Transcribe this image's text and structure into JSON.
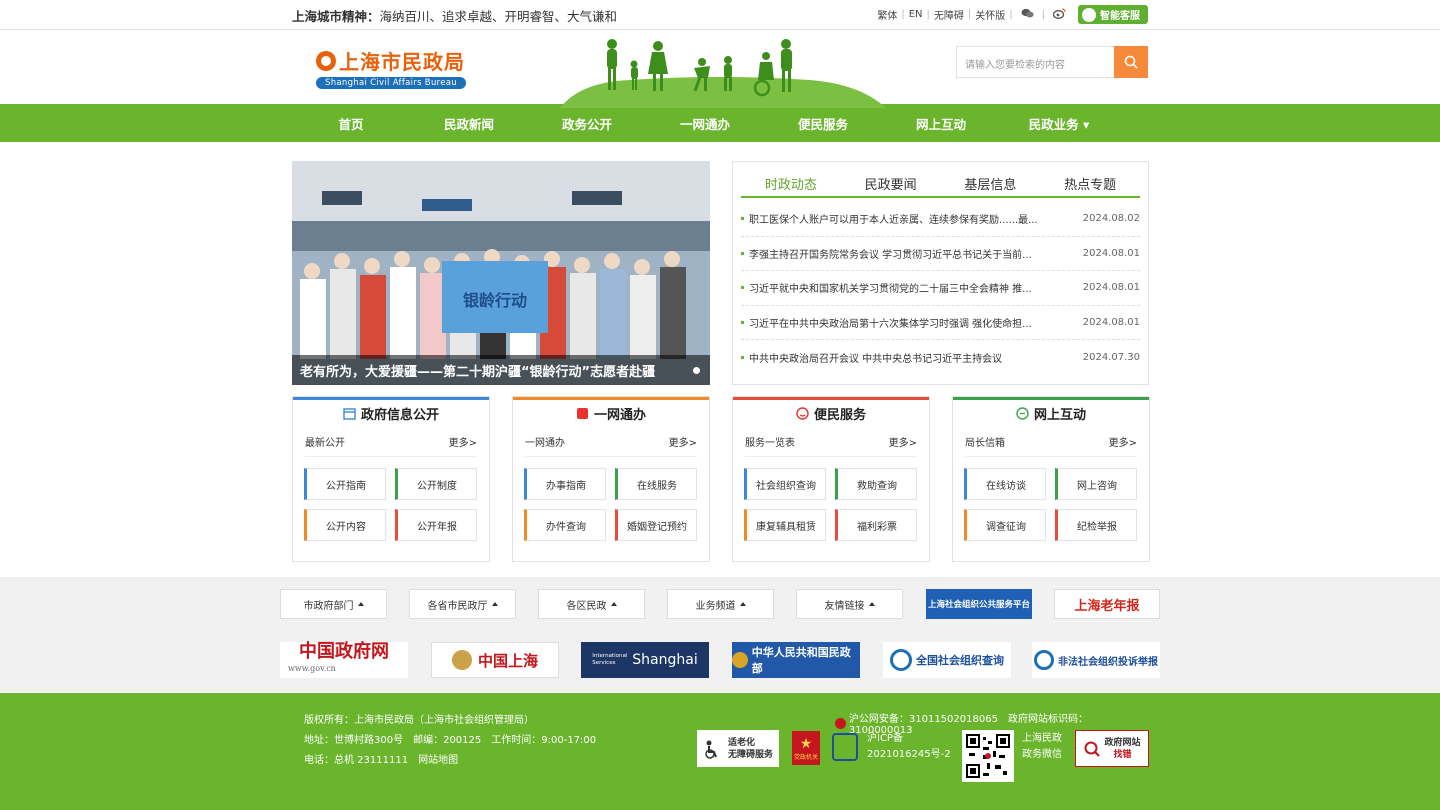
{
  "topbar": {
    "slogan_head": "上海城市精神：",
    "slogan_rest": "海纳百川、追求卓越、开明睿智、大气谦和",
    "links": [
      "繁体",
      "EN",
      "无障碍",
      "关怀版"
    ],
    "kefu": "智能客服"
  },
  "header": {
    "logo_cn": "上海市民政局",
    "logo_en": "Shanghai Civil Affairs Bureau",
    "search_placeholder": "请输入您要检索的内容"
  },
  "nav": [
    "首页",
    "民政新闻",
    "政务公开",
    "一网通办",
    "便民服务",
    "网上互动",
    "民政业务 ▾"
  ],
  "slide": {
    "caption": "老有所为，大爱援疆——第二十期沪疆“银龄行动”志愿者赴疆",
    "banner_text": "银龄行动"
  },
  "news": {
    "tabs": [
      "时政动态",
      "民政要闻",
      "基层信息",
      "热点专题"
    ],
    "items": [
      {
        "title": "职工医保个人账户可以用于本人近亲属、连续参保有奖励......最...",
        "date": "2024.08.02"
      },
      {
        "title": "李强主持召开国务院常务会议 学习贯彻习近平总书记关于当前...",
        "date": "2024.08.01"
      },
      {
        "title": "习近平就中央和国家机关学习贯彻党的二十届三中全会精神 推...",
        "date": "2024.08.01"
      },
      {
        "title": "习近平在中共中央政治局第十六次集体学习时强调 强化使命担...",
        "date": "2024.08.01"
      },
      {
        "title": "中共中央政治局召开会议 中共中央总书记习近平主持会议",
        "date": "2024.07.30"
      }
    ]
  },
  "cards": [
    {
      "title": "政府信息公开",
      "sub": "最新公开",
      "more": "更多>",
      "color": "#3a88d6",
      "btns": [
        "公开指南",
        "公开制度",
        "公开内容",
        "公开年报"
      ]
    },
    {
      "title": "一网通办",
      "sub": "一网通办",
      "more": "更多>",
      "color": "#f08a24",
      "btns": [
        "办事指南",
        "在线服务",
        "办件查询",
        "婚姻登记预约"
      ]
    },
    {
      "title": "便民服务",
      "sub": "服务一览表",
      "more": "更多>",
      "color": "#e84c3d",
      "btns": [
        "社会组织查询",
        "救助查询",
        "康复辅具租赁",
        "福利彩票"
      ]
    },
    {
      "title": "网上互动",
      "sub": "局长信箱",
      "more": "更多>",
      "color": "#3aa34a",
      "btns": [
        "在线访谈",
        "网上咨询",
        "调查征询",
        "纪检举报"
      ]
    }
  ],
  "links": {
    "drops": [
      "市政府部门",
      "各省市民政厅",
      "各区民政",
      "业务频道",
      "友情链接"
    ],
    "logos": [
      "上海社会组织公共服务平台",
      "上海老年报",
      "中国政府网",
      "www.gov.cn",
      "中国上海",
      "International Services",
      "Shanghai",
      "中华人民共和国民政部",
      "全国社会组织查询",
      "非法社会组织投诉举报"
    ]
  },
  "footer": {
    "line1": "版权所有：上海市民政局（上海市社会组织管理局）",
    "line2": "地址：世博村路300号　邮编：200125　工作时间：9:00-17:00",
    "line3": "电话：总机 23111111　网站地图",
    "security": "沪公网安备：31011502018065　政府网站标识码：3100000013",
    "aging1": "适老化",
    "aging2": "无障碍服务",
    "icp1": "沪ICP备",
    "icp2": "2021016245号-2",
    "wechat1": "上海民政",
    "wechat2": "政务微信",
    "report1": "政府网站",
    "report2": "找错",
    "party": "党政机关"
  }
}
